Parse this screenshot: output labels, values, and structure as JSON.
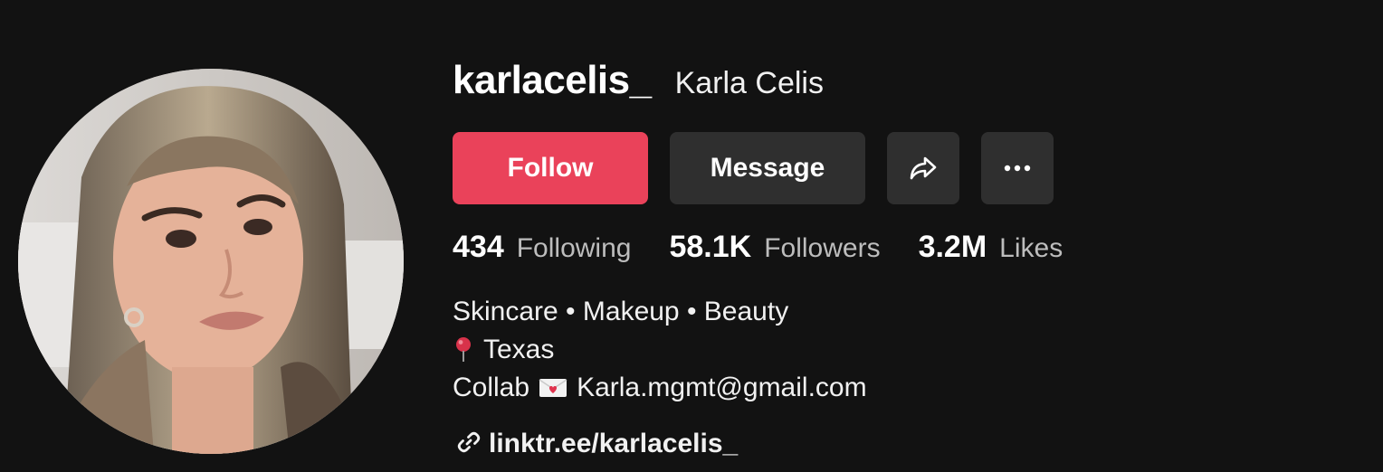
{
  "profile": {
    "username": "karlacelis_",
    "display_name": "Karla Celis"
  },
  "actions": {
    "follow_label": "Follow",
    "message_label": "Message",
    "share_icon": "share-arrow-icon",
    "more_icon": "more-horizontal-icon"
  },
  "stats": {
    "following_count": "434",
    "following_label": "Following",
    "followers_count": "58.1K",
    "followers_label": "Followers",
    "likes_count": "3.2M",
    "likes_label": "Likes"
  },
  "bio": {
    "line1": "Skincare • Makeup • Beauty",
    "location": "Texas",
    "collab_prefix": "Collab",
    "email": "Karla.mgmt@gmail.com"
  },
  "link": {
    "text": "linktr.ee/karlacelis_",
    "icon": "link-icon"
  },
  "colors": {
    "background": "#121212",
    "follow_button": "#ea425a",
    "secondary_button": "#2f2f2f",
    "muted_text": "#bdbdbd"
  }
}
